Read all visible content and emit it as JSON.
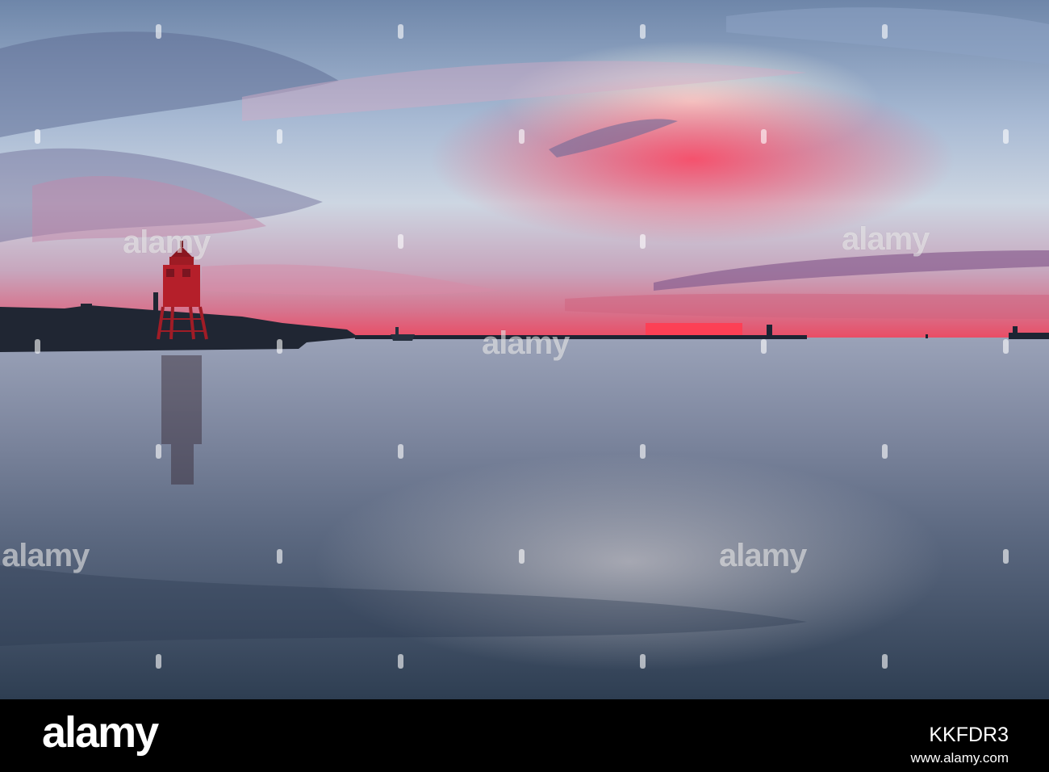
{
  "watermark": {
    "text": "alamy"
  },
  "footer": {
    "logo": "alamy",
    "image_id": "KKFDR3",
    "url": "www.alamy.com"
  },
  "colors": {
    "sky_top": "#6f86a8",
    "sky_mid": "#b6c6d8",
    "sunset_glow": "#e5405c",
    "sea": "#56647c",
    "sea_dark": "#2f3f52",
    "lighthouse": "#b01d28",
    "footer_bg": "#000000"
  }
}
